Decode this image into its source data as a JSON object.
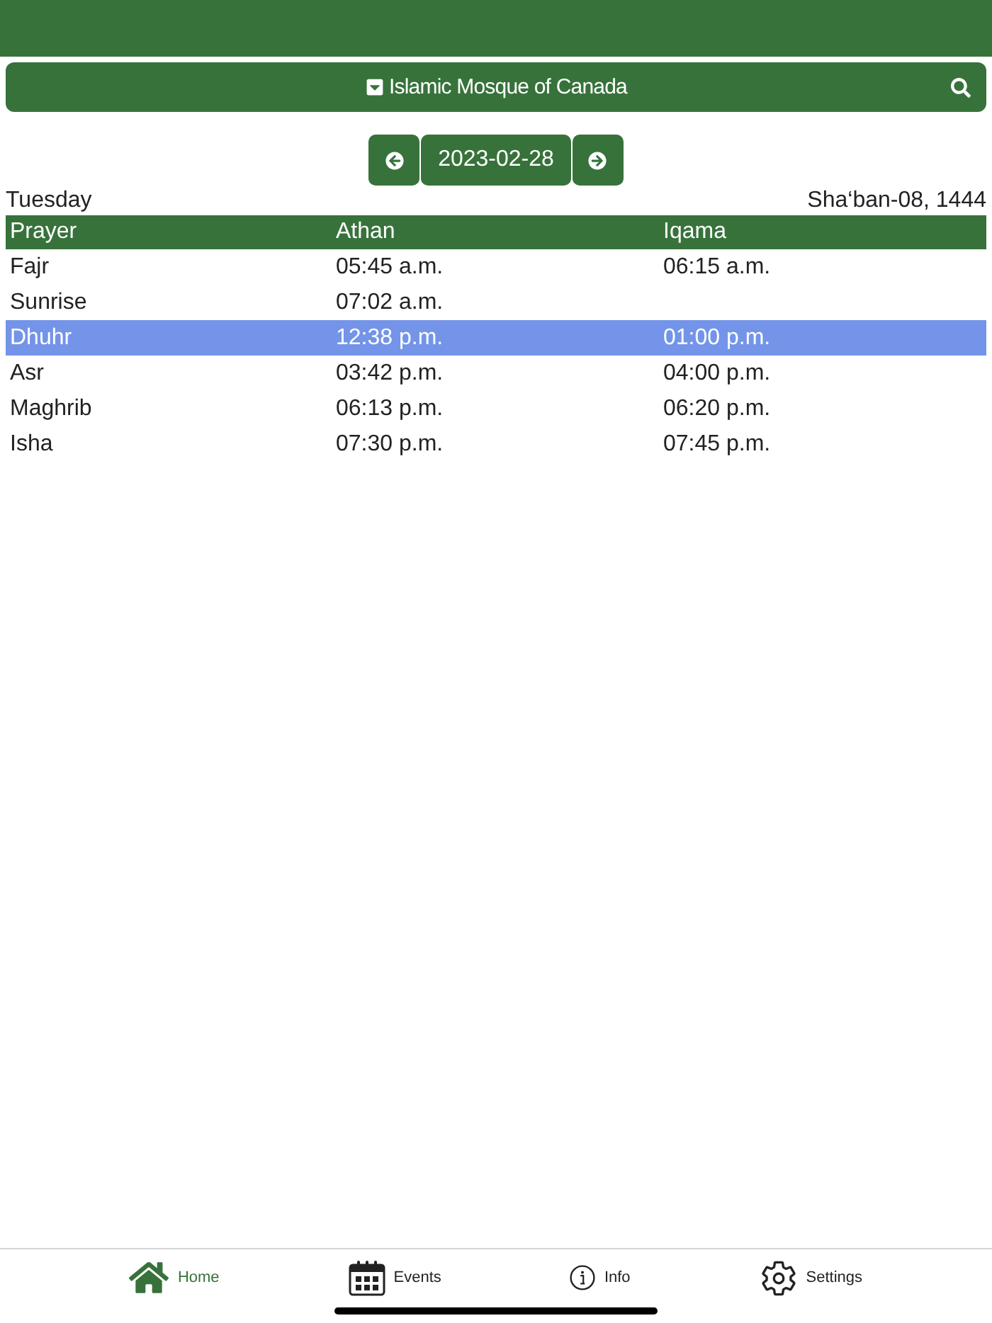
{
  "header": {
    "title": "Islamic Mosque of Canada"
  },
  "date_nav": {
    "date": "2023-02-28"
  },
  "day": {
    "weekday": "Tuesday",
    "hijri_date": "Sha‘ban-08, 1444"
  },
  "table": {
    "columns": [
      "Prayer",
      "Athan",
      "Iqama"
    ],
    "rows": [
      {
        "prayer": "Fajr",
        "athan": "05:45 a.m.",
        "iqama": "06:15 a.m.",
        "selected": false
      },
      {
        "prayer": "Sunrise",
        "athan": "07:02 a.m.",
        "selected": false
      },
      {
        "prayer": "Dhuhr",
        "athan": "12:38 p.m.",
        "iqama": "01:00 p.m.",
        "selected": true
      },
      {
        "prayer": "Asr",
        "athan": "03:42 p.m.",
        "iqama": "04:00 p.m.",
        "selected": false
      },
      {
        "prayer": "Maghrib",
        "athan": "06:13 p.m.",
        "iqama": "06:20 p.m.",
        "selected": false
      },
      {
        "prayer": "Isha",
        "athan": "07:30 p.m.",
        "iqama": "07:45 p.m.",
        "selected": false
      }
    ]
  },
  "tabs": [
    {
      "label": "Home",
      "kind": "home",
      "selected": true
    },
    {
      "label": "Events",
      "kind": "events",
      "selected": false
    },
    {
      "label": "Info",
      "kind": "info",
      "selected": false
    },
    {
      "label": "Settings",
      "kind": "settings",
      "selected": false
    }
  ]
}
